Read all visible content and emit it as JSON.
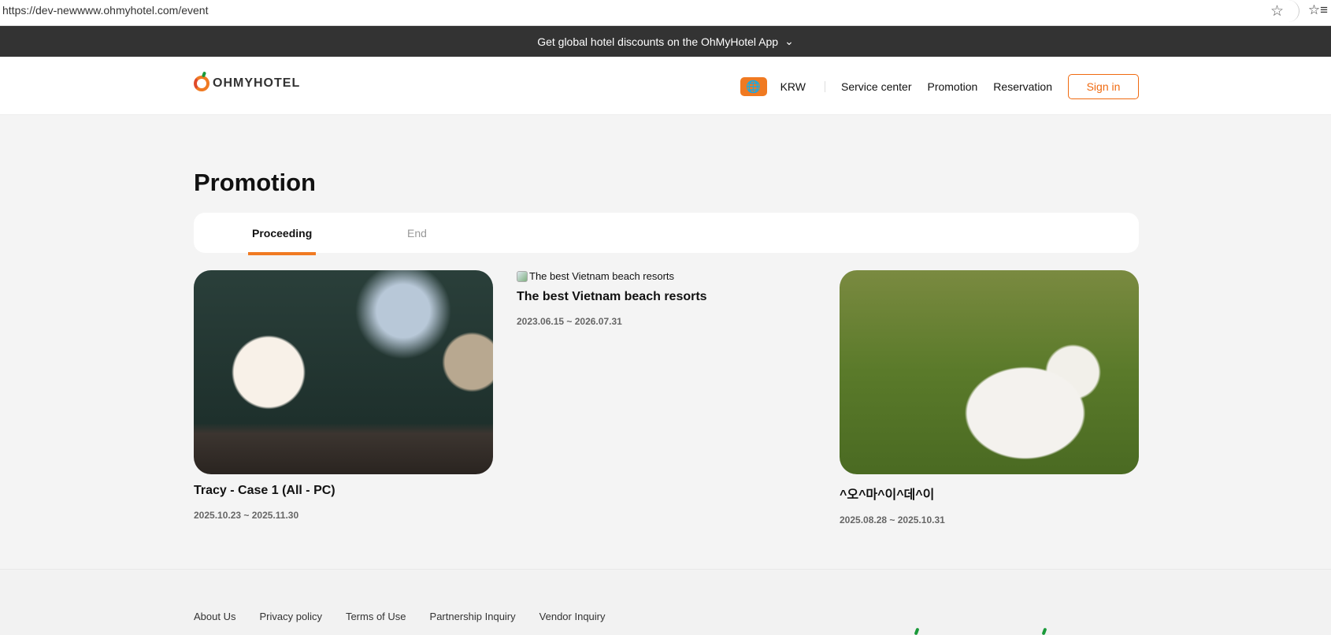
{
  "browser": {
    "url": "https://dev-newwww.ohmyhotel.com/event"
  },
  "banner": {
    "text": "Get global hotel discounts on the OhMyHotel App"
  },
  "header": {
    "logo": "OHMYHOTEL",
    "currency": "KRW",
    "nav": [
      "Service center",
      "Promotion",
      "Reservation"
    ],
    "signin": "Sign in"
  },
  "page": {
    "title": "Promotion",
    "tabs": [
      "Proceeding",
      "End"
    ],
    "active_tab": "Proceeding"
  },
  "cards": [
    {
      "title": "Tracy - Case 1 (All - PC)",
      "date": "2025.10.23 ~ 2025.11.30"
    },
    {
      "img_alt": "The best Vietnam beach resorts",
      "title": "The best Vietnam beach resorts",
      "date": "2023.06.15 ~ 2026.07.31"
    },
    {
      "title": "^오^마^이^데^이",
      "date": "2025.08.28 ~ 2025.10.31"
    }
  ],
  "footer": {
    "links": [
      "About Us",
      "Privacy policy",
      "Terms of Use",
      "Partnership Inquiry",
      "Vendor Inquiry"
    ]
  },
  "colors": {
    "accent": "#f07a22",
    "banner": "#333333"
  }
}
